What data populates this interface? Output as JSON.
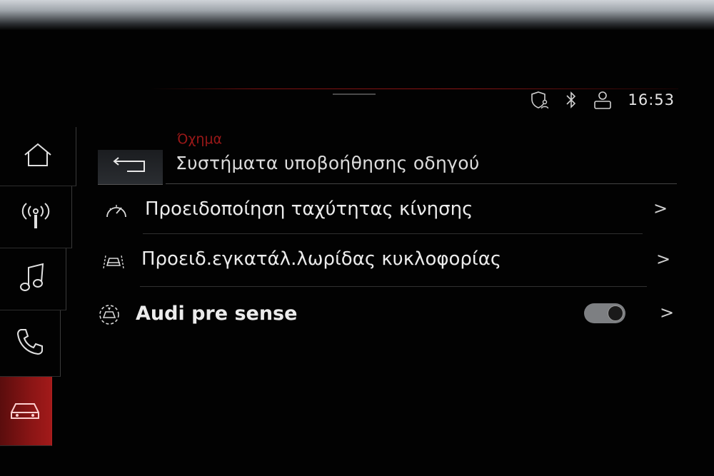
{
  "status_bar": {
    "time": "16:53",
    "icons": [
      "shield-user-icon",
      "bluetooth-icon",
      "user-profile-icon"
    ]
  },
  "sidebar": {
    "items": [
      {
        "icon": "home-icon",
        "active": false
      },
      {
        "icon": "radio-icon",
        "active": false
      },
      {
        "icon": "music-icon",
        "active": false
      },
      {
        "icon": "phone-icon",
        "active": false
      },
      {
        "icon": "car-icon",
        "active": true
      }
    ]
  },
  "header": {
    "breadcrumb": "Όχημα",
    "title": "Συστήματα υποβοήθησης οδηγού",
    "back_icon": "back-arrow-icon"
  },
  "list": {
    "items": [
      {
        "label": "Προειδοποίηση ταχύτητας κίνησης",
        "icon": "speedometer-icon",
        "chevron": ">"
      },
      {
        "label": "Προειδ.εγκατάλ.λωρίδας κυκλοφορίας",
        "icon": "lane-departure-icon",
        "chevron": ">"
      },
      {
        "label": "Audi pre sense",
        "icon": "pre-sense-icon",
        "chevron": ">",
        "toggle_on": true
      }
    ]
  },
  "colors": {
    "accent_red": "#a21a1a",
    "breadcrumb_red": "#9a1818",
    "text": "#ececec",
    "background": "#020202"
  }
}
